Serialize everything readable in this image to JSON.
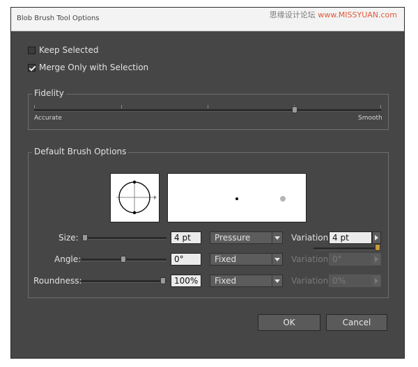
{
  "window": {
    "title": "Blob Brush Tool Options"
  },
  "watermark": {
    "text_cn": "思缘设计论坛",
    "text_url": "www.MISSYUAN.com"
  },
  "options": {
    "keep_selected": {
      "label": "Keep Selected",
      "checked": false
    },
    "merge_only": {
      "label": "Merge Only with Selection",
      "checked": true
    }
  },
  "fidelity": {
    "legend": "Fidelity",
    "left_label": "Accurate",
    "right_label": "Smooth",
    "value_fraction": 0.75
  },
  "brush": {
    "legend": "Default Brush Options",
    "size": {
      "label": "Size:",
      "value": "4 pt",
      "mode": "Pressure",
      "variation_label": "Variation:",
      "variation": "4 pt"
    },
    "angle": {
      "label": "Angle:",
      "value": "0°",
      "mode": "Fixed",
      "variation_label": "Variation:",
      "variation": "0°"
    },
    "roundness": {
      "label": "Roundness:",
      "value": "100%",
      "mode": "Fixed",
      "variation_label": "Variation:",
      "variation": "0%"
    }
  },
  "buttons": {
    "ok": "OK",
    "cancel": "Cancel"
  },
  "colors": {
    "dialog_bg": "#464646",
    "field_bg": "#ebebeb",
    "accent_thumb": "#c79a3a"
  }
}
